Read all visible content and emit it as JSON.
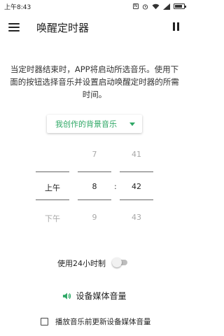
{
  "status_bar": {
    "time": "上午8:43",
    "badge": "N"
  },
  "app_bar": {
    "title": "唤醒定时器"
  },
  "description": "当定时器结束时，APP将启动所选音乐。使用下面的按钮选择音乐并设置启动唤醒定时器的所需时间。",
  "music_dropdown": {
    "selected": "我创作的背景音乐"
  },
  "time_picker": {
    "ampm": {
      "above": "",
      "selected": "上午",
      "below": "下午"
    },
    "hour": {
      "above": "7",
      "selected": "8",
      "below": "9"
    },
    "minute": {
      "above": "41",
      "selected": "42",
      "below": "43"
    },
    "separator": ":"
  },
  "toggle_24h": {
    "label": "使用24小时制",
    "enabled": false
  },
  "media_volume": {
    "label": "设备媒体音量"
  },
  "checkbox_update_volume": {
    "label": "播放音乐前更新设备媒体音量",
    "checked": false
  },
  "colors": {
    "accent": "#2fa866"
  }
}
